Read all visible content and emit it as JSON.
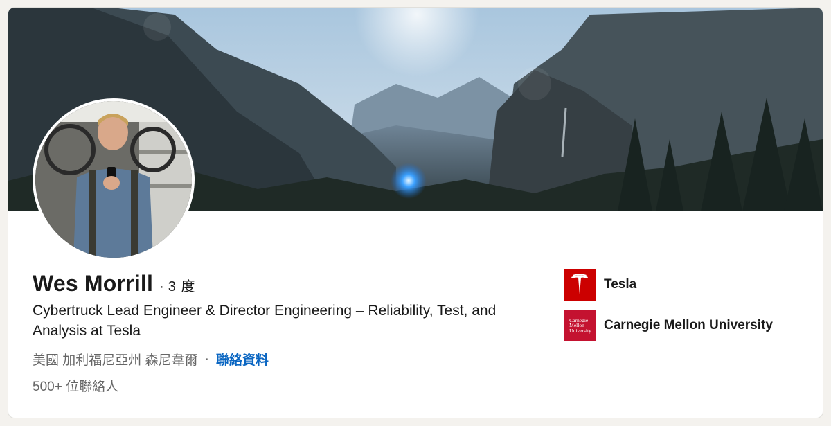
{
  "profile": {
    "name": "Wes Morrill",
    "degree_separator": "·",
    "degree": "3 度",
    "headline": "Cybertruck Lead Engineer & Director Engineering – Reliability, Test, and Analysis at Tesla",
    "location": "美國 加利福尼亞州 森尼韋爾",
    "location_separator": "·",
    "contact_info_label": "聯絡資料",
    "connections": "500+ 位聯絡人"
  },
  "organizations": [
    {
      "name": "Tesla",
      "icon": "tesla-logo",
      "color": "#cc0000"
    },
    {
      "name": "Carnegie Mellon University",
      "icon": "cmu-logo",
      "color": "#c41230",
      "logo_text": [
        "Carnegie",
        "Mellon",
        "University"
      ]
    }
  ],
  "colors": {
    "link": "#0a66c2",
    "primary_text": "#191919",
    "secondary_text": "#666666"
  }
}
